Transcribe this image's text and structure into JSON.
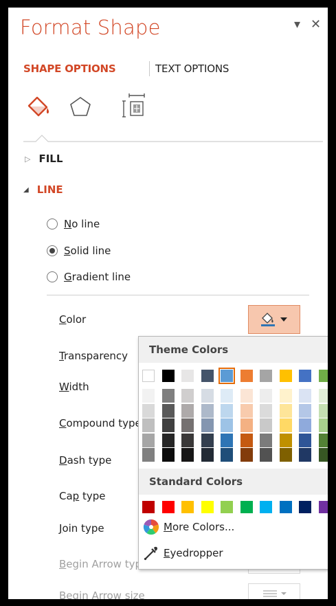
{
  "panel": {
    "title": "Format Shape",
    "dropdown_glyph": "▾",
    "close_glyph": "✕"
  },
  "tabs": {
    "shape_options": "SHAPE OPTIONS",
    "text_options": "TEXT OPTIONS"
  },
  "icons": {
    "fill_line": "fill-bucket-icon",
    "effects": "pentagon-icon",
    "size_properties": "size-properties-icon"
  },
  "sections": {
    "fill": {
      "label": "FILL",
      "glyph": "▷"
    },
    "line": {
      "label": "LINE",
      "glyph": "◢"
    }
  },
  "line_options": [
    {
      "key": "N",
      "rest": "o line",
      "selected": false
    },
    {
      "key": "S",
      "rest": "olid line",
      "selected": true
    },
    {
      "key": "G",
      "rest": "radient line",
      "selected": false
    }
  ],
  "properties": {
    "color": {
      "key": "C",
      "rest": "olor"
    },
    "transparency": {
      "key": "T",
      "rest": "ransparency"
    },
    "width": {
      "key": "W",
      "rest": "idth"
    },
    "compound": {
      "key": "C",
      "rest": "ompound type"
    },
    "dash": {
      "key": "D",
      "rest": "ash type"
    },
    "cap": {
      "before": "Ca",
      "key": "p",
      "rest": " type"
    },
    "join": {
      "key": "J",
      "rest": "oin type"
    },
    "begin_arrow_type": {
      "key": "B",
      "rest": "egin Arrow type"
    },
    "begin_arrow_size": {
      "key": "B",
      "rest": "egin Arrow size"
    }
  },
  "color_picker": {
    "theme_heading": "Theme Colors",
    "standard_heading": "Standard Colors",
    "theme_top": [
      "#ffffff",
      "#000000",
      "#e7e6e6",
      "#44546a",
      "#5b9bd5",
      "#ed7d31",
      "#a5a5a5",
      "#ffc000",
      "#4472c4",
      "#70ad47"
    ],
    "theme_shades": [
      [
        "#f2f2f2",
        "#d9d9d9",
        "#bfbfbf",
        "#a6a6a6",
        "#808080"
      ],
      [
        "#7f7f7f",
        "#595959",
        "#404040",
        "#262626",
        "#0d0d0d"
      ],
      [
        "#d0cece",
        "#aeaaaa",
        "#757171",
        "#3a3838",
        "#171616"
      ],
      [
        "#d6dce4",
        "#adb9ca",
        "#8496b0",
        "#333f4f",
        "#222a35"
      ],
      [
        "#deebf6",
        "#bdd7ee",
        "#9dc3e6",
        "#2e75b5",
        "#1f4e79"
      ],
      [
        "#fbe5d5",
        "#f8cbad",
        "#f4b183",
        "#c55a11",
        "#833c0b"
      ],
      [
        "#ededed",
        "#dbdbdb",
        "#c9c9c9",
        "#7b7b7b",
        "#525252"
      ],
      [
        "#fff2cc",
        "#fee599",
        "#ffd965",
        "#bf9000",
        "#7f6000"
      ],
      [
        "#dae3f3",
        "#b4c7e7",
        "#8faadc",
        "#2f5597",
        "#203864"
      ],
      [
        "#e2efd9",
        "#c5e0b3",
        "#a8d08d",
        "#538135",
        "#375623"
      ]
    ],
    "standard": [
      "#c00000",
      "#ff0000",
      "#ffc000",
      "#ffff00",
      "#92d050",
      "#00b050",
      "#00b0f0",
      "#0070c0",
      "#002060",
      "#7030a0"
    ],
    "selected_index": 4,
    "more_colors": {
      "key": "M",
      "rest": "ore Colors..."
    },
    "eyedropper": {
      "key": "E",
      "rest": "yedropper"
    }
  },
  "colors": {
    "accent": "#d24726",
    "button_highlight": "#f7c7ae",
    "selected_border": "#e46c0a"
  }
}
